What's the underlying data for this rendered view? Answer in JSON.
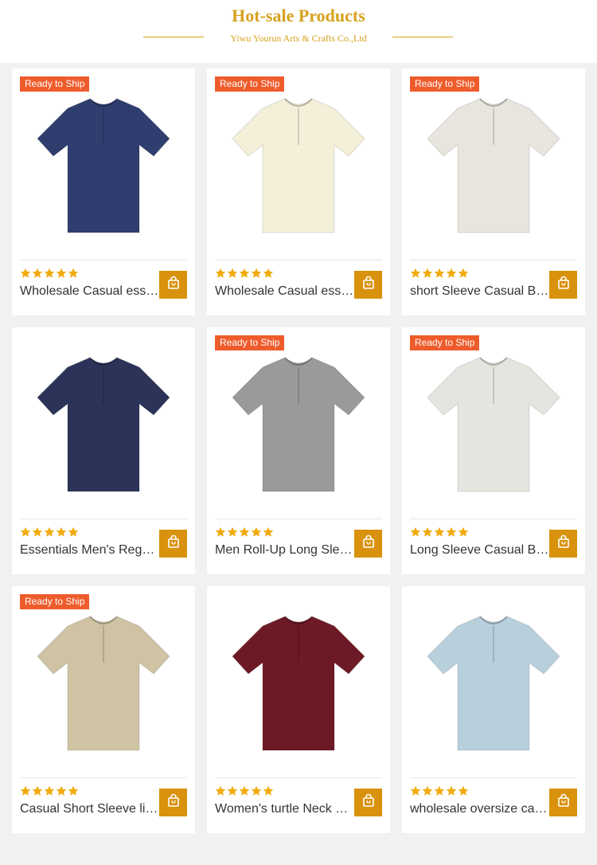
{
  "header": {
    "title": "Hot-sale Products",
    "subtitle": "Yiwu Yourun Arts & Crafts Co.,Ltd",
    "accent_color": "#d7a11d"
  },
  "badge_color": "#ee5c2c",
  "cart_color": "#d9920e",
  "products": [
    {
      "name": "Wholesale Casual essentials men's linen henley shirt",
      "badge": "Ready to Ship",
      "rating": 5,
      "shirt_color": "#2f3e6e",
      "icon": "shopping-bag-icon"
    },
    {
      "name": "Wholesale Casual essentials men's sleeveless lace-up tank",
      "badge": "Ready to Ship",
      "rating": 5,
      "shirt_color": "#f4efd9",
      "icon": "shopping-bag-icon"
    },
    {
      "name": "short Sleeve Casual Button henley shirt",
      "badge": "Ready to Ship",
      "rating": 5,
      "shirt_color": "#e8e5de",
      "icon": "shopping-bag-icon"
    },
    {
      "name": "Essentials Men's Regular fit linen shirt",
      "badge": "",
      "rating": 5,
      "shirt_color": "#2b3358",
      "icon": "shopping-bag-icon"
    },
    {
      "name": "Men Roll-Up Long Sleeve linen shirt",
      "badge": "Ready to Ship",
      "rating": 5,
      "shirt_color": "#9a9a9a",
      "icon": "shopping-bag-icon"
    },
    {
      "name": "Long Sleeve Casual Button linen shirt",
      "badge": "Ready to Ship",
      "rating": 5,
      "shirt_color": "#e6e4df",
      "icon": "shopping-bag-icon"
    },
    {
      "name": "Casual Short Sleeve linen henley shirt",
      "badge": "Ready to Ship",
      "rating": 5,
      "shirt_color": "#cfc3a3",
      "icon": "shopping-bag-icon"
    },
    {
      "name": "Women's turtle Neck batwing top",
      "badge": "",
      "rating": 5,
      "shirt_color": "#6e1a26",
      "icon": "shopping-bag-icon"
    },
    {
      "name": "wholesale oversize casual t-shirt",
      "badge": "",
      "rating": 5,
      "shirt_color": "#b8cfdc",
      "icon": "shopping-bag-icon"
    }
  ]
}
